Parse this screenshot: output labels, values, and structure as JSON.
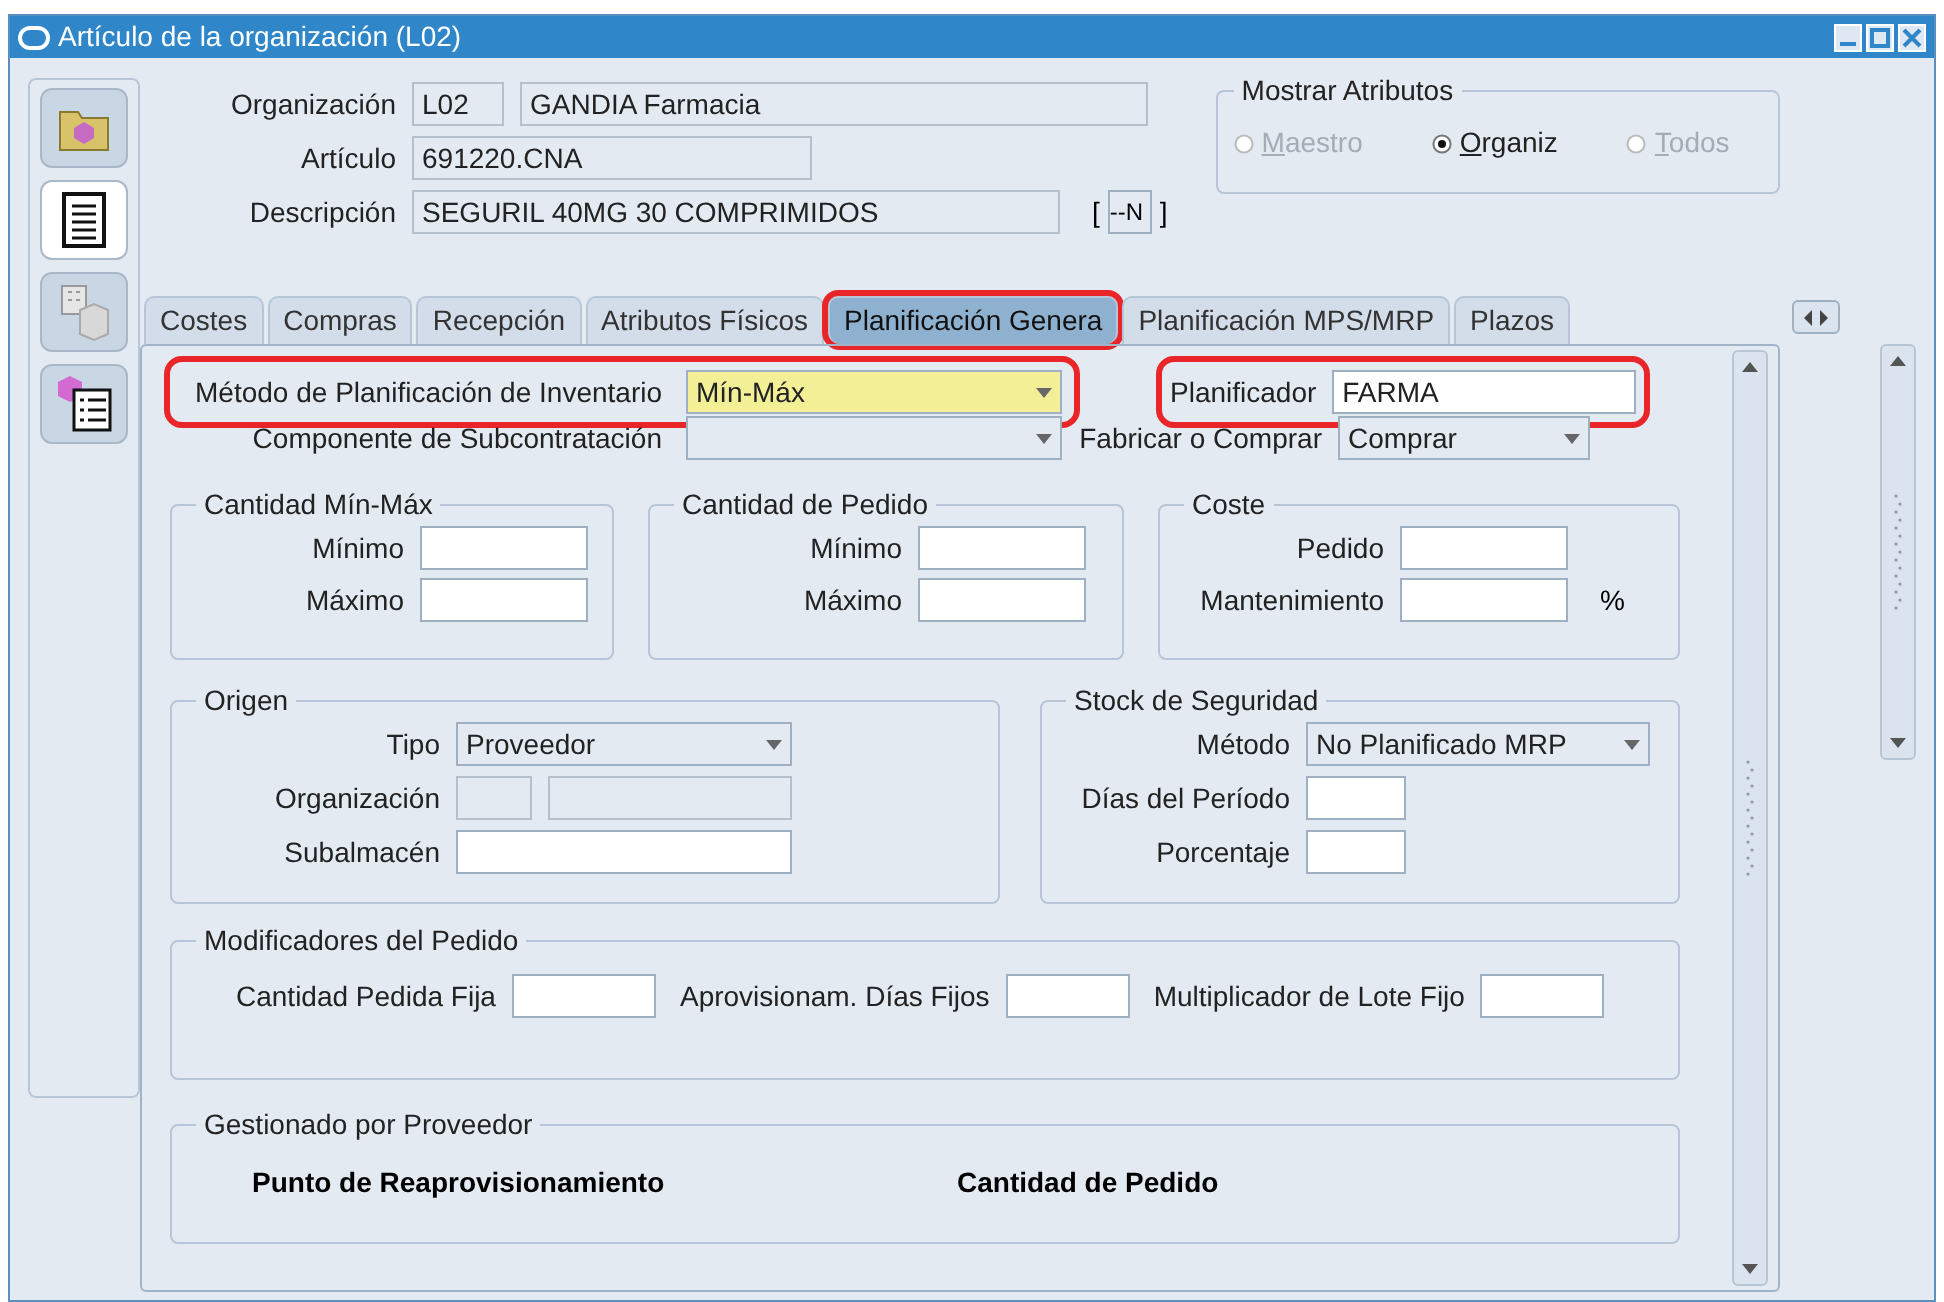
{
  "window": {
    "title": "Artículo de la organización (L02)"
  },
  "toolbar": [
    {
      "kind": "folder",
      "selected": false
    },
    {
      "kind": "document",
      "selected": true
    },
    {
      "kind": "building",
      "selected": false
    },
    {
      "kind": "list",
      "selected": false
    }
  ],
  "header": {
    "organizacion": {
      "label": "Organización",
      "code": "L02",
      "name": "GANDIA Farmacia"
    },
    "articulo": {
      "label": "Artículo",
      "value": "691220.CNA"
    },
    "descripcion": {
      "label": "Descripción",
      "value": "SEGURIL 40MG 30 COMPRIMIDOS",
      "open_bracket": "[",
      "revision": "--N",
      "close_bracket": "]"
    }
  },
  "mostrar_atributos": {
    "title": "Mostrar Atributos",
    "options": [
      {
        "label": "Maestro",
        "selected": false,
        "disabled": true
      },
      {
        "label": "Organiz",
        "selected": true,
        "disabled": false
      },
      {
        "label": "Todos",
        "selected": false,
        "disabled": true
      }
    ]
  },
  "tabs": [
    {
      "label": "Costes",
      "selected": false,
      "highlighted": false
    },
    {
      "label": "Compras",
      "selected": false,
      "highlighted": false
    },
    {
      "label": "Recepción",
      "selected": false,
      "highlighted": false
    },
    {
      "label": "Atributos Físicos",
      "selected": false,
      "highlighted": false
    },
    {
      "label": "Planificación Genera",
      "selected": true,
      "highlighted": true
    },
    {
      "label": "Planificación MPS/MRP",
      "selected": false,
      "highlighted": false
    },
    {
      "label": "Plazos",
      "selected": false,
      "highlighted": false
    }
  ],
  "metodo": {
    "label": "Método de Planificación de Inventario",
    "value": "Mín-Máx",
    "highlighted": true
  },
  "planificador": {
    "label": "Planificador",
    "value": "FARMA",
    "highlighted": true
  },
  "componente": {
    "label": "Componente de Subcontratación"
  },
  "fabricar": {
    "label": "Fabricar o Comprar",
    "value": "Comprar"
  },
  "cantidad_min_max": {
    "title": "Cantidad Mín-Máx",
    "fields": [
      {
        "label": "Mínimo"
      },
      {
        "label": "Máximo"
      }
    ]
  },
  "cantidad_pedido": {
    "title": "Cantidad de Pedido",
    "fields": [
      {
        "label": "Mínimo"
      },
      {
        "label": "Máximo"
      }
    ]
  },
  "coste": {
    "title": "Coste",
    "fields": [
      {
        "label": "Pedido"
      },
      {
        "label": "Mantenimiento",
        "suffix": "%"
      }
    ]
  },
  "origen": {
    "title": "Origen",
    "fields": [
      {
        "kind": "dropdown",
        "label": "Tipo",
        "value": "Proveedor"
      },
      {
        "kind": "pair",
        "label": "Organización"
      },
      {
        "kind": "text",
        "label": "Subalmacén"
      }
    ]
  },
  "stock_seguridad": {
    "title": "Stock de Seguridad",
    "fields": [
      {
        "kind": "dropdown",
        "label": "Método",
        "value": "No Planificado MRP"
      },
      {
        "kind": "text",
        "label": "Días del Período"
      },
      {
        "kind": "text",
        "label": "Porcentaje"
      }
    ]
  },
  "modificadores": {
    "title": "Modificadores del Pedido",
    "fields": [
      {
        "label": "Cantidad Pedida Fija"
      },
      {
        "label": "Aprovisionam. Días Fijos"
      },
      {
        "label": "Multiplicador de Lote Fijo"
      }
    ]
  },
  "gestionado": {
    "title": "Gestionado por Proveedor",
    "columns": [
      "Punto de Reaprovisionamiento",
      "Cantidad de Pedido"
    ]
  }
}
